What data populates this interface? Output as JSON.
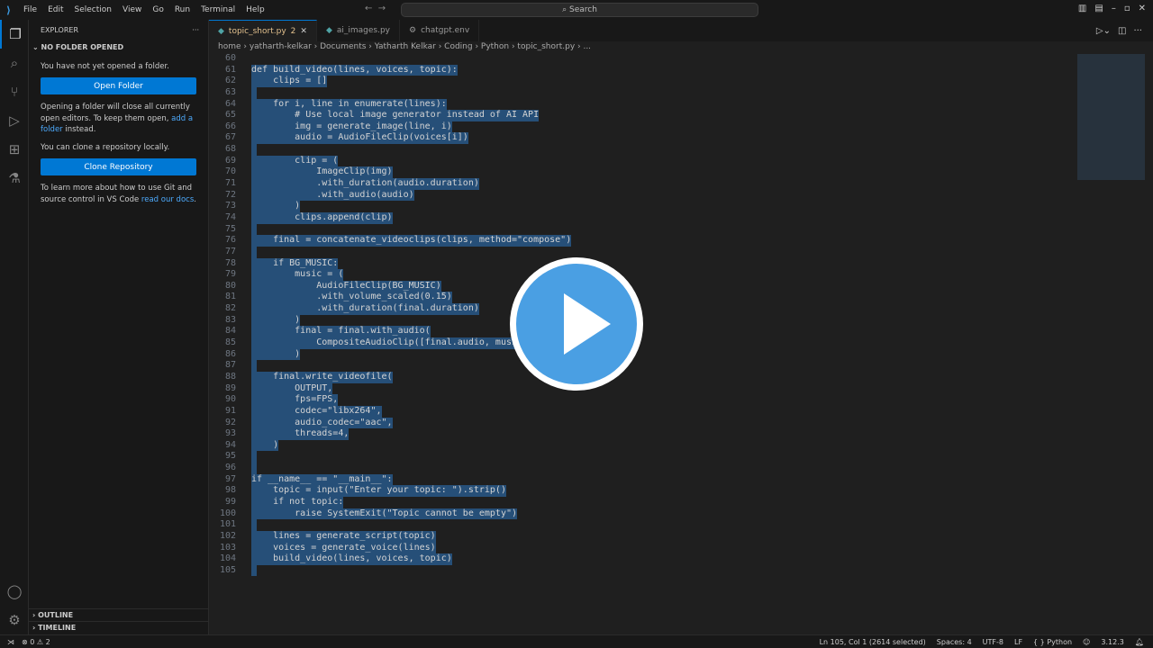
{
  "titlebar": {
    "menu": [
      "File",
      "Edit",
      "Selection",
      "View",
      "Go",
      "Run",
      "Terminal",
      "Help"
    ],
    "search": "Search"
  },
  "sidebar": {
    "title": "EXPLORER",
    "section": "NO FOLDER OPENED",
    "p1": "You have not yet opened a folder.",
    "open_folder": "Open Folder",
    "p2a": "Opening a folder will close all currently open editors. To keep them open, ",
    "p2link": "add a folder",
    "p2b": " instead.",
    "p3": "You can clone a repository locally.",
    "clone": "Clone Repository",
    "p4a": "To learn more about how to use Git and source control in VS Code ",
    "p4link": "read our docs",
    "p4b": ".",
    "outline": "OUTLINE",
    "timeline": "TIMELINE"
  },
  "tabs": [
    {
      "label": "topic_short.py",
      "badge": "2"
    },
    {
      "label": "ai_images.py"
    },
    {
      "label": "chatgpt.env"
    }
  ],
  "breadcrumb": "home › yatharth-kelkar › Documents › Yatharth Kelkar › Coding › Python › topic_short.py › ...",
  "code": {
    "start": 60,
    "sel_start": 61,
    "lines": [
      "",
      "def build_video(lines, voices, topic):",
      "    clips = []",
      "",
      "    for i, line in enumerate(lines):",
      "        # Use local image generator instead of AI API",
      "        img = generate_image(line, i)",
      "        audio = AudioFileClip(voices[i])",
      "",
      "        clip = (",
      "            ImageClip(img)",
      "            .with_duration(audio.duration)",
      "            .with_audio(audio)",
      "        )",
      "        clips.append(clip)",
      "",
      "    final = concatenate_videoclips(clips, method=\"compose\")",
      "",
      "    if BG_MUSIC:",
      "        music = (",
      "            AudioFileClip(BG_MUSIC)",
      "            .with_volume_scaled(0.15)",
      "            .with_duration(final.duration)",
      "        )",
      "        final = final.with_audio(",
      "            CompositeAudioClip([final.audio, music])",
      "        )",
      "",
      "    final.write_videofile(",
      "        OUTPUT,",
      "        fps=FPS,",
      "        codec=\"libx264\",",
      "        audio_codec=\"aac\",",
      "        threads=4,",
      "    )",
      "",
      "",
      "if __name__ == \"__main__\":",
      "    topic = input(\"Enter your topic: \").strip()",
      "    if not topic:",
      "        raise SystemExit(\"Topic cannot be empty\")",
      "",
      "    lines = generate_script(topic)",
      "    voices = generate_voice(lines)",
      "    build_video(lines, voices, topic)",
      ""
    ]
  },
  "status": {
    "problems": "⊗ 0 ⚠ 2",
    "position": "Ln 105, Col 1 (2614 selected)",
    "spaces": "Spaces: 4",
    "encoding": "UTF-8",
    "eol": "LF",
    "language": "{ } Python",
    "version": "3.12.3"
  },
  "colors": {
    "accent": "#0078d4",
    "selection": "#264f78",
    "play": "#4a9fe3"
  }
}
